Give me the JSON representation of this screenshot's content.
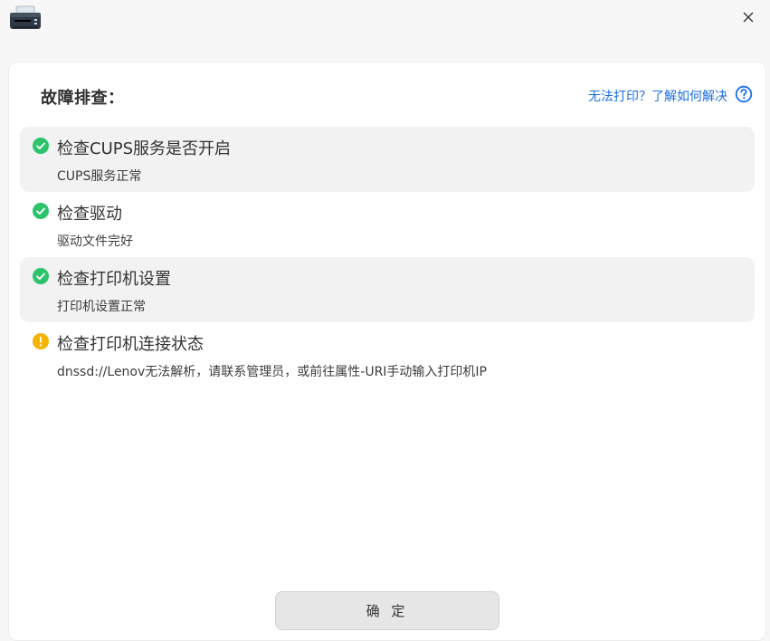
{
  "window": {
    "app_icon": "printer-icon",
    "close_icon": "close-icon"
  },
  "header": {
    "title": "故障排查：",
    "help_link": "无法打印？了解如何解决",
    "help_icon": "help-circle-icon"
  },
  "checks": [
    {
      "title": "检查CUPS服务是否开启",
      "desc": "CUPS服务正常",
      "status": "ok",
      "icon": "check-circle-icon"
    },
    {
      "title": "检查驱动",
      "desc": "驱动文件完好",
      "status": "ok",
      "icon": "check-circle-icon"
    },
    {
      "title": "检查打印机设置",
      "desc": "打印机设置正常",
      "status": "ok",
      "icon": "check-circle-icon"
    },
    {
      "title": "检查打印机连接状态",
      "desc": "dnssd://Lenov无法解析，请联系管理员，或前往属性-URI手动输入打印机IP",
      "status": "warning",
      "icon": "warning-circle-icon"
    }
  ],
  "footer": {
    "ok_label": "确 定"
  },
  "colors": {
    "ok": "#2cc36b",
    "warning": "#f5b400",
    "link": "#1a6ee8"
  }
}
